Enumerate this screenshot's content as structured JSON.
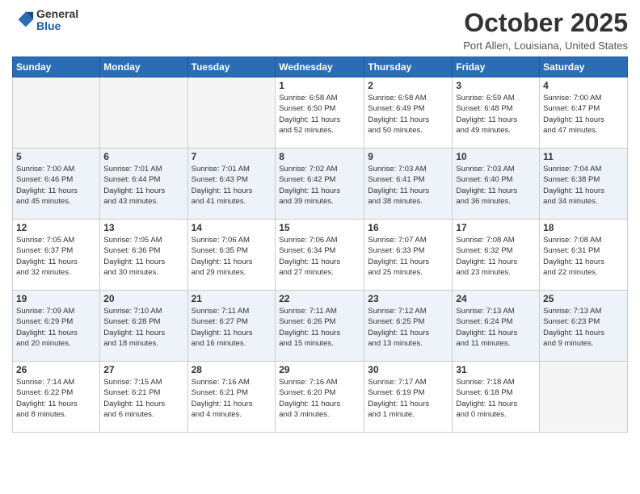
{
  "header": {
    "logo_general": "General",
    "logo_blue": "Blue",
    "month": "October 2025",
    "location": "Port Allen, Louisiana, United States"
  },
  "days_of_week": [
    "Sunday",
    "Monday",
    "Tuesday",
    "Wednesday",
    "Thursday",
    "Friday",
    "Saturday"
  ],
  "weeks": [
    [
      {
        "day": "",
        "content": ""
      },
      {
        "day": "",
        "content": ""
      },
      {
        "day": "",
        "content": ""
      },
      {
        "day": "1",
        "content": "Sunrise: 6:58 AM\nSunset: 6:50 PM\nDaylight: 11 hours\nand 52 minutes."
      },
      {
        "day": "2",
        "content": "Sunrise: 6:58 AM\nSunset: 6:49 PM\nDaylight: 11 hours\nand 50 minutes."
      },
      {
        "day": "3",
        "content": "Sunrise: 6:59 AM\nSunset: 6:48 PM\nDaylight: 11 hours\nand 49 minutes."
      },
      {
        "day": "4",
        "content": "Sunrise: 7:00 AM\nSunset: 6:47 PM\nDaylight: 11 hours\nand 47 minutes."
      }
    ],
    [
      {
        "day": "5",
        "content": "Sunrise: 7:00 AM\nSunset: 6:46 PM\nDaylight: 11 hours\nand 45 minutes."
      },
      {
        "day": "6",
        "content": "Sunrise: 7:01 AM\nSunset: 6:44 PM\nDaylight: 11 hours\nand 43 minutes."
      },
      {
        "day": "7",
        "content": "Sunrise: 7:01 AM\nSunset: 6:43 PM\nDaylight: 11 hours\nand 41 minutes."
      },
      {
        "day": "8",
        "content": "Sunrise: 7:02 AM\nSunset: 6:42 PM\nDaylight: 11 hours\nand 39 minutes."
      },
      {
        "day": "9",
        "content": "Sunrise: 7:03 AM\nSunset: 6:41 PM\nDaylight: 11 hours\nand 38 minutes."
      },
      {
        "day": "10",
        "content": "Sunrise: 7:03 AM\nSunset: 6:40 PM\nDaylight: 11 hours\nand 36 minutes."
      },
      {
        "day": "11",
        "content": "Sunrise: 7:04 AM\nSunset: 6:38 PM\nDaylight: 11 hours\nand 34 minutes."
      }
    ],
    [
      {
        "day": "12",
        "content": "Sunrise: 7:05 AM\nSunset: 6:37 PM\nDaylight: 11 hours\nand 32 minutes."
      },
      {
        "day": "13",
        "content": "Sunrise: 7:05 AM\nSunset: 6:36 PM\nDaylight: 11 hours\nand 30 minutes."
      },
      {
        "day": "14",
        "content": "Sunrise: 7:06 AM\nSunset: 6:35 PM\nDaylight: 11 hours\nand 29 minutes."
      },
      {
        "day": "15",
        "content": "Sunrise: 7:06 AM\nSunset: 6:34 PM\nDaylight: 11 hours\nand 27 minutes."
      },
      {
        "day": "16",
        "content": "Sunrise: 7:07 AM\nSunset: 6:33 PM\nDaylight: 11 hours\nand 25 minutes."
      },
      {
        "day": "17",
        "content": "Sunrise: 7:08 AM\nSunset: 6:32 PM\nDaylight: 11 hours\nand 23 minutes."
      },
      {
        "day": "18",
        "content": "Sunrise: 7:08 AM\nSunset: 6:31 PM\nDaylight: 11 hours\nand 22 minutes."
      }
    ],
    [
      {
        "day": "19",
        "content": "Sunrise: 7:09 AM\nSunset: 6:29 PM\nDaylight: 11 hours\nand 20 minutes."
      },
      {
        "day": "20",
        "content": "Sunrise: 7:10 AM\nSunset: 6:28 PM\nDaylight: 11 hours\nand 18 minutes."
      },
      {
        "day": "21",
        "content": "Sunrise: 7:11 AM\nSunset: 6:27 PM\nDaylight: 11 hours\nand 16 minutes."
      },
      {
        "day": "22",
        "content": "Sunrise: 7:11 AM\nSunset: 6:26 PM\nDaylight: 11 hours\nand 15 minutes."
      },
      {
        "day": "23",
        "content": "Sunrise: 7:12 AM\nSunset: 6:25 PM\nDaylight: 11 hours\nand 13 minutes."
      },
      {
        "day": "24",
        "content": "Sunrise: 7:13 AM\nSunset: 6:24 PM\nDaylight: 11 hours\nand 11 minutes."
      },
      {
        "day": "25",
        "content": "Sunrise: 7:13 AM\nSunset: 6:23 PM\nDaylight: 11 hours\nand 9 minutes."
      }
    ],
    [
      {
        "day": "26",
        "content": "Sunrise: 7:14 AM\nSunset: 6:22 PM\nDaylight: 11 hours\nand 8 minutes."
      },
      {
        "day": "27",
        "content": "Sunrise: 7:15 AM\nSunset: 6:21 PM\nDaylight: 11 hours\nand 6 minutes."
      },
      {
        "day": "28",
        "content": "Sunrise: 7:16 AM\nSunset: 6:21 PM\nDaylight: 11 hours\nand 4 minutes."
      },
      {
        "day": "29",
        "content": "Sunrise: 7:16 AM\nSunset: 6:20 PM\nDaylight: 11 hours\nand 3 minutes."
      },
      {
        "day": "30",
        "content": "Sunrise: 7:17 AM\nSunset: 6:19 PM\nDaylight: 11 hours\nand 1 minute."
      },
      {
        "day": "31",
        "content": "Sunrise: 7:18 AM\nSunset: 6:18 PM\nDaylight: 11 hours\nand 0 minutes."
      },
      {
        "day": "",
        "content": ""
      }
    ]
  ]
}
